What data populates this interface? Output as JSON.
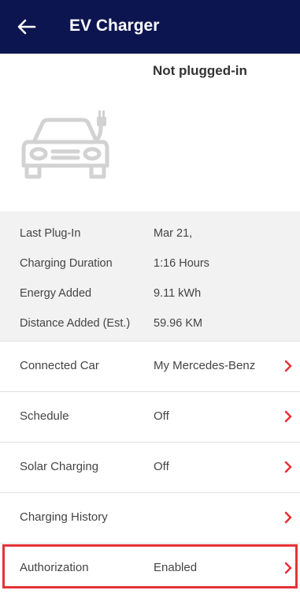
{
  "header": {
    "title": "EV Charger",
    "back_icon": "arrow-left-icon"
  },
  "status": "Not plugged-in",
  "car_icon": "car-charging-icon",
  "stats": [
    {
      "label": "Last Plug-In",
      "value": "Mar 21,"
    },
    {
      "label": "Charging Duration",
      "value": "1:16 Hours"
    },
    {
      "label": "Energy Added",
      "value": "9.11 kWh"
    },
    {
      "label": "Distance Added (Est.)",
      "value": "59.96 KM"
    }
  ],
  "settings": [
    {
      "label": "Connected Car",
      "value": "My Mercedes-Benz"
    },
    {
      "label": "Schedule",
      "value": "Off"
    },
    {
      "label": "Solar Charging",
      "value": "Off"
    },
    {
      "label": "Charging History",
      "value": ""
    },
    {
      "label": "Authorization",
      "value": "Enabled"
    }
  ],
  "colors": {
    "header_bg": "#0d1550",
    "accent": "#e53238",
    "stats_bg": "#f2f2f2"
  }
}
